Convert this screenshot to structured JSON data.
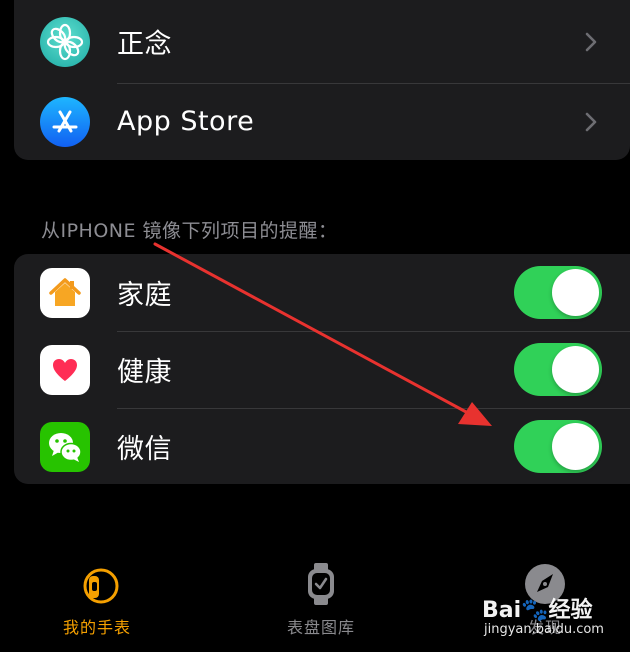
{
  "top_group": {
    "items": [
      {
        "label": "正念",
        "icon": "mindfulness-icon",
        "icon_color": "#3ec9c0"
      },
      {
        "label": "App Store",
        "icon": "app-store-icon",
        "icon_color": "#1a8cff"
      }
    ]
  },
  "mirror_section": {
    "header": "从IPHONE 镜像下列项目的提醒：",
    "items": [
      {
        "label": "家庭",
        "icon": "home-icon",
        "icon_color": "#f5a623",
        "enabled": true
      },
      {
        "label": "健康",
        "icon": "health-icon",
        "icon_color": "#ff2d55",
        "enabled": true
      },
      {
        "label": "微信",
        "icon": "wechat-icon",
        "icon_color": "#2dc100",
        "enabled": true
      }
    ]
  },
  "tabbar": {
    "tabs": [
      {
        "label": "我的手表",
        "icon": "watch-icon",
        "active": true
      },
      {
        "label": "表盘图库",
        "icon": "watch-face-icon",
        "active": false
      },
      {
        "label": "发现",
        "icon": "compass-icon",
        "active": false
      }
    ]
  },
  "watermark": {
    "brand": "Bai🐾经验",
    "url": "jingyan.baidu.com"
  },
  "colors": {
    "toggle_on": "#30d158",
    "active_tab": "#f5a000",
    "annotation_arrow": "#e8322f"
  }
}
